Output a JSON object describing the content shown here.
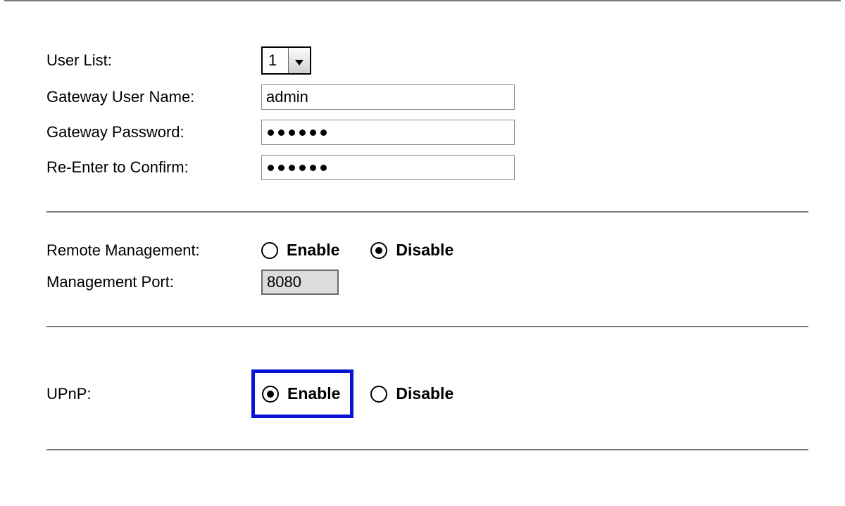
{
  "userList": {
    "label": "User List:",
    "value": "1"
  },
  "gatewayUser": {
    "label": "Gateway User Name:",
    "value": "admin"
  },
  "gatewayPassword": {
    "label": "Gateway Password:",
    "dots": 6
  },
  "confirmPassword": {
    "label": "Re-Enter to Confirm:",
    "dots": 6
  },
  "remoteMgmt": {
    "label": "Remote Management:",
    "enable": "Enable",
    "disable": "Disable",
    "selected": "disable"
  },
  "mgmtPort": {
    "label": "Management Port:",
    "value": "8080"
  },
  "upnp": {
    "label": "UPnP:",
    "enable": "Enable",
    "disable": "Disable",
    "selected": "enable",
    "highlight": "enable"
  }
}
